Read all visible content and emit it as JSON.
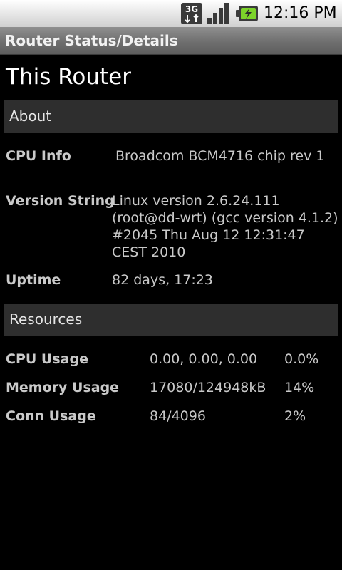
{
  "status_bar": {
    "network_type": "3G",
    "time": "12:16 PM",
    "icons": [
      "3g-data-icon",
      "signal-strength-icon",
      "battery-charging-icon"
    ]
  },
  "title_bar": {
    "title": "Router Status/Details"
  },
  "page": {
    "heading": "This Router"
  },
  "about": {
    "header": "About",
    "cpu_info": {
      "label": "CPU Info",
      "value": "Broadcom BCM4716 chip rev 1"
    },
    "version_string": {
      "label": "Version String",
      "lines": [
        "Linux version 2.6.24.111",
        "(root@dd-wrt) (gcc version 4.1.2)",
        "#2045 Thu Aug 12 12:31:47",
        "CEST 2010"
      ]
    },
    "uptime": {
      "label": "Uptime",
      "value": "82 days, 17:23"
    }
  },
  "resources": {
    "header": "Resources",
    "rows": [
      {
        "label": "CPU Usage",
        "value": "0.00, 0.00, 0.00",
        "percent": "0.0%"
      },
      {
        "label": "Memory Usage",
        "value": "17080/124948kB",
        "percent": "14%"
      },
      {
        "label": "Conn Usage",
        "value": "84/4096",
        "percent": "2%"
      }
    ]
  },
  "colors": {
    "background": "#000000",
    "section_header_bg": "#2e2e2e",
    "text": "#c9c9c9",
    "heading_text": "#ffffff"
  }
}
